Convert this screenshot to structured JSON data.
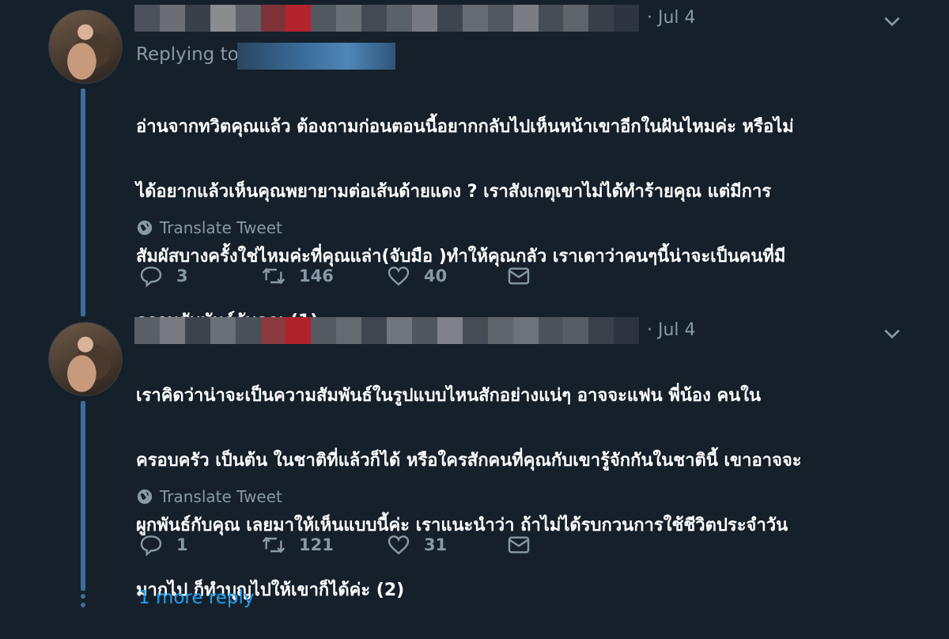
{
  "tweets": [
    {
      "date": "· Jul 4",
      "replying_prefix": "Replying to",
      "text_lines": [
        "อ่านจากทวิตคุณแล้ว ต้องถามก่อนตอนนี้อยากกลับไปเห็นหน้าเขาอีกในฝันไหมค่ะ หรือไม่",
        "ได้อยากแล้วเห็นคุณพยายามต่อเส้นด้ายแดง ? เราสังเกตุเขาไม่ได้ทำร้ายคุณ แต่มีการ",
        "สัมผัสบางครั้งใช่ไหมค่ะที่คุณแล่า(จับมือ )ทำให้คุณกลัว เราเดาว่าคนๆนี้น่าจะเป็นคนที่มี",
        "ความสัมพันธ์กับคุณ (1)"
      ],
      "translate_label": "Translate Tweet",
      "counts": {
        "replies": "3",
        "retweets": "146",
        "likes": "40"
      }
    },
    {
      "date": "· Jul 4",
      "text_lines": [
        "เราคิดว่าน่าจะเป็นความสัมพันธ์ในรูปแบบไหนสักอย่างแน่ๆ อาจจะแฟน พี่น้อง คนใน",
        "ครอบครัว เป็นต้น ในชาติที่แล้วก็ได้ หรือใครสักคนที่คุณกับเขารู้จักกันในชาตินี้ เขาอาจจะ",
        "ผูกพันธ์กับคุณ เลยมาให้เห็นแบบนี้ค่ะ เราแนะนำว่า ถ้าไม่ได้รบกวนการใช้ชีวิตประจำวัน",
        "มากไป ก็ทำบุญไปให้เขาก็ได้ค่ะ (2)"
      ],
      "translate_label": "Translate Tweet",
      "counts": {
        "replies": "1",
        "retweets": "121",
        "likes": "31"
      }
    }
  ],
  "more_reply": "1 more reply",
  "colors": {
    "background": "#15202b",
    "muted": "#8899a6",
    "link": "#1da1f2",
    "thread": "#3b6e9a"
  }
}
